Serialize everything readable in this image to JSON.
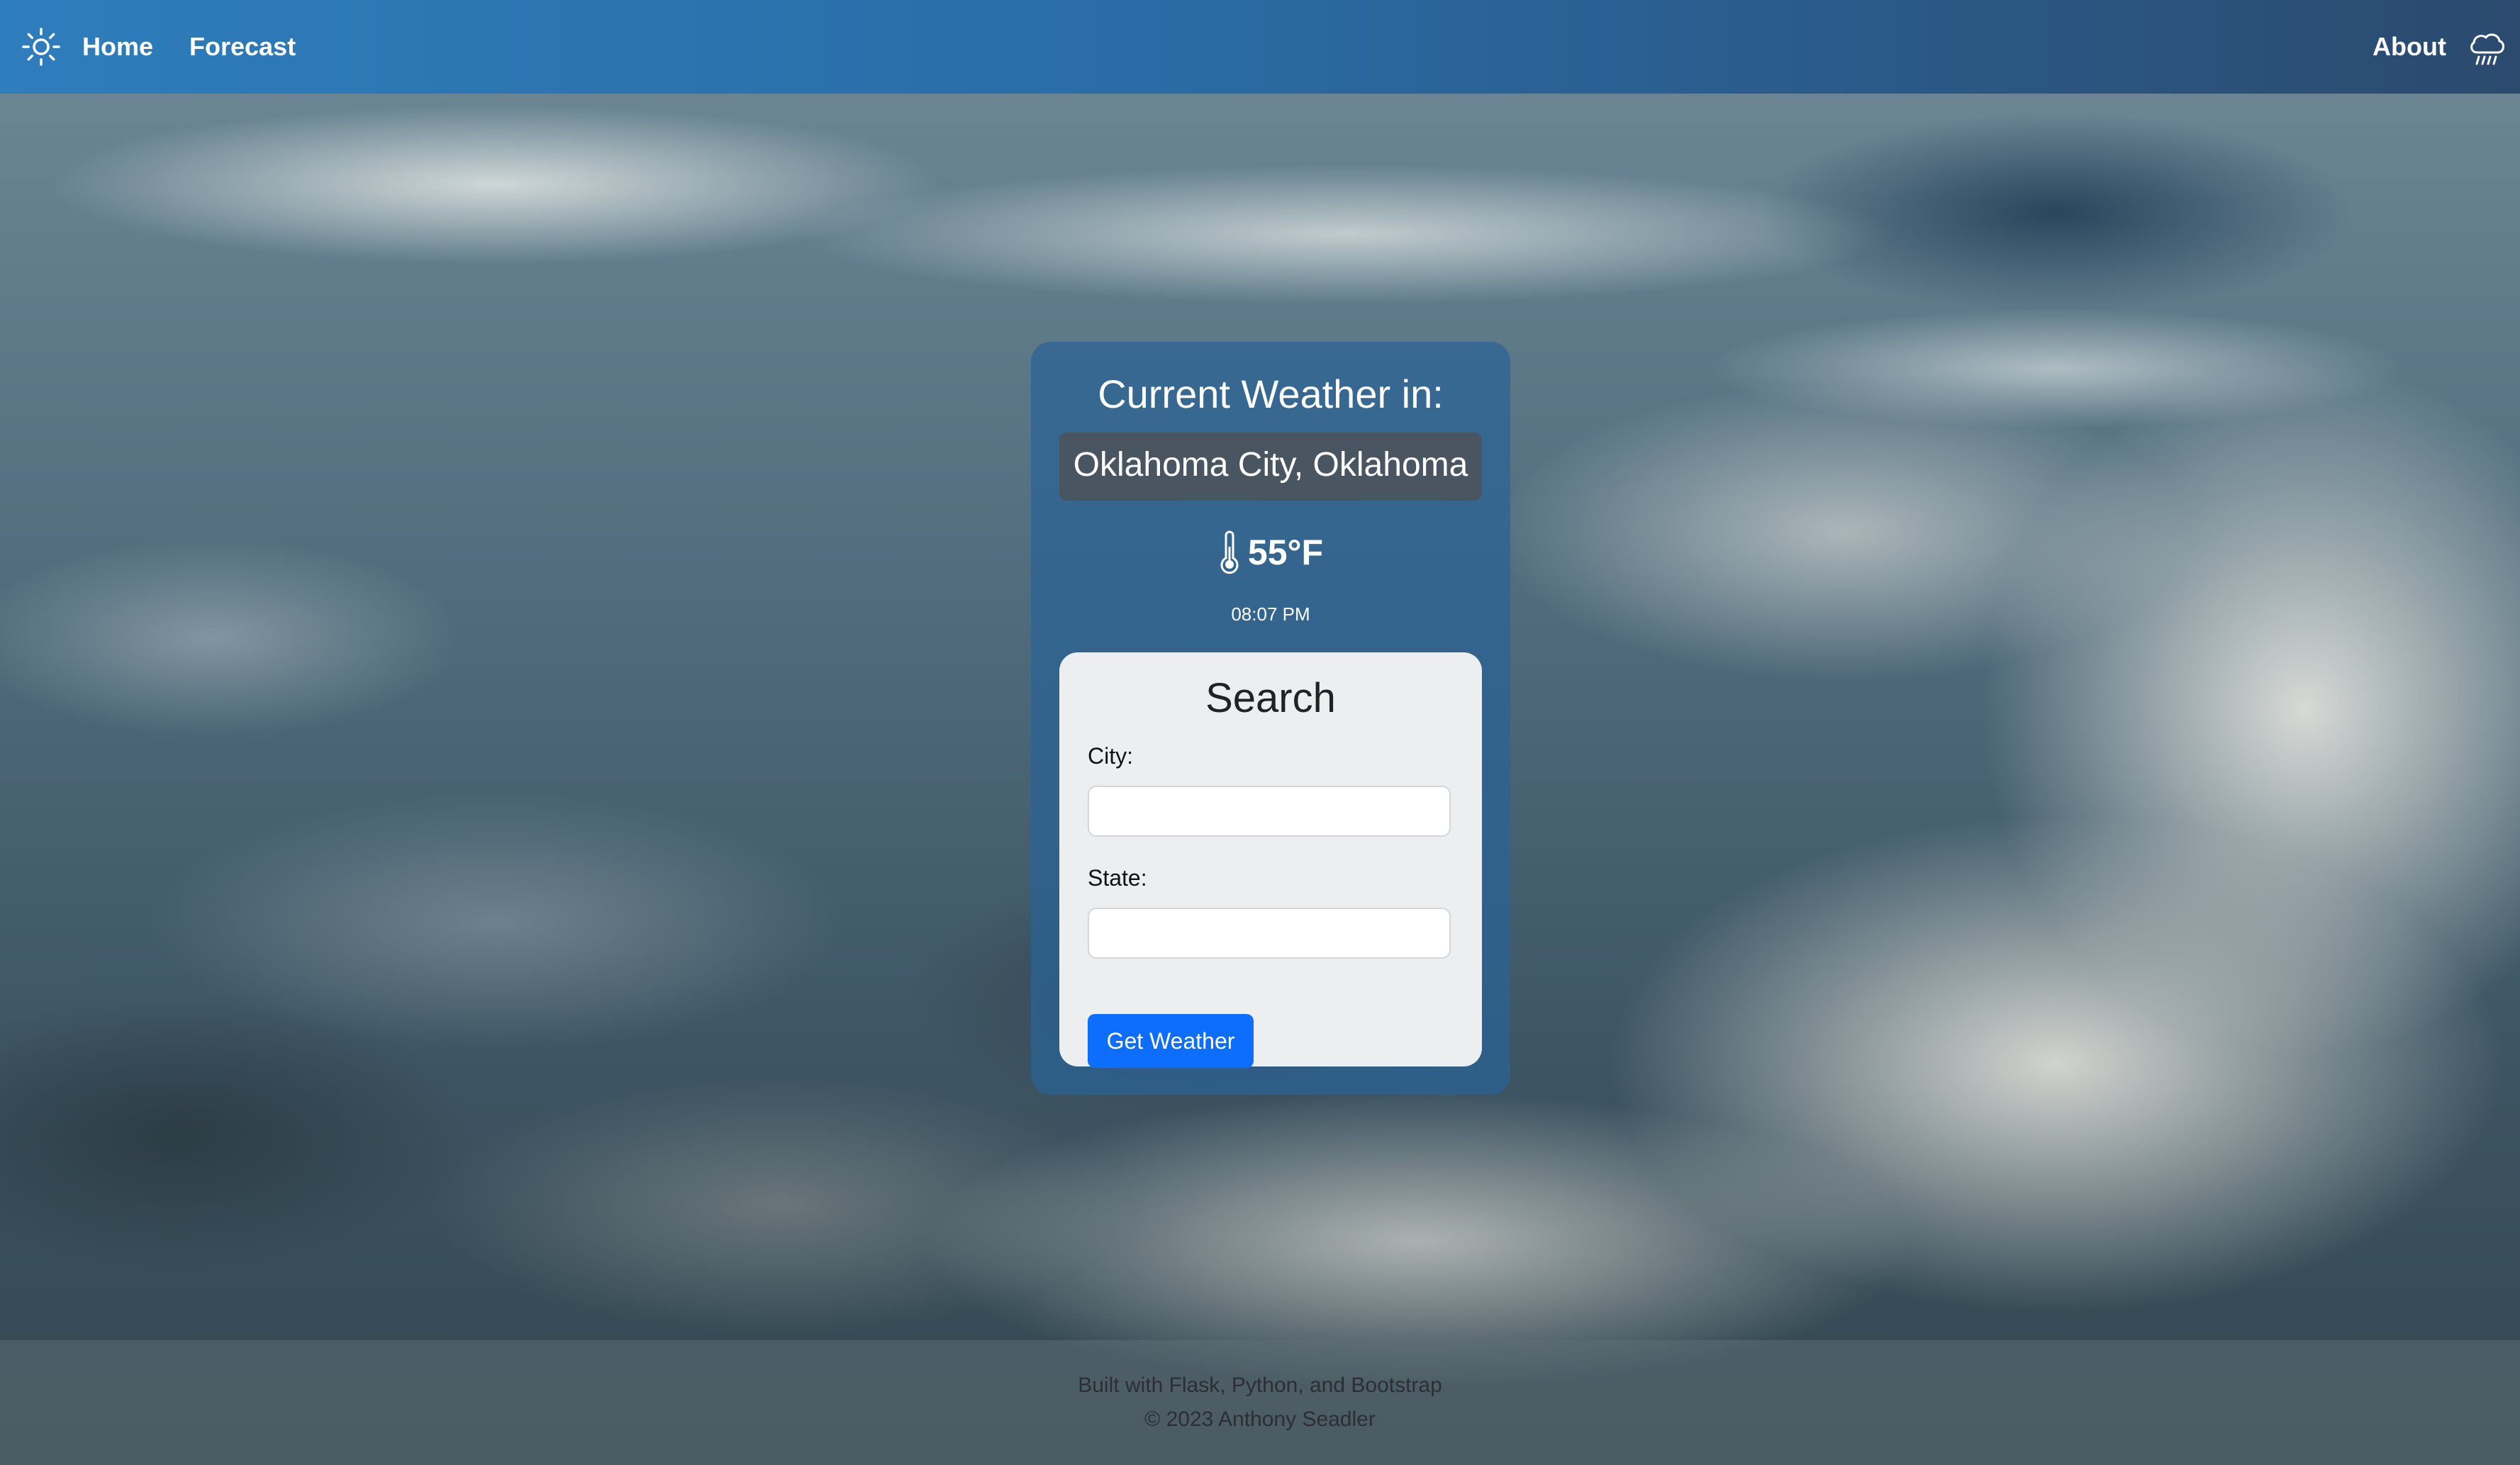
{
  "nav": {
    "brand_icon": "sun-icon",
    "home_label": "Home",
    "forecast_label": "Forecast",
    "about_label": "About",
    "about_icon": "cloud-rain-icon"
  },
  "weather": {
    "title": "Current Weather in:",
    "location": "Oklahoma City, Oklahoma",
    "temperature_icon": "thermometer-icon",
    "temperature": "55°F",
    "time": "08:07 PM"
  },
  "search": {
    "title": "Search",
    "city_label": "City:",
    "city_value": "",
    "state_label": "State:",
    "state_value": "",
    "submit_label": "Get Weather"
  },
  "footer": {
    "line1": "Built with Flask, Python, and Bootstrap",
    "line2": "© 2023 Anthony Seadler"
  },
  "colors": {
    "navbar_start": "#2e7dbc",
    "navbar_end": "#2b4a6e",
    "button": "#0d6efd",
    "card": "#2a6296"
  }
}
